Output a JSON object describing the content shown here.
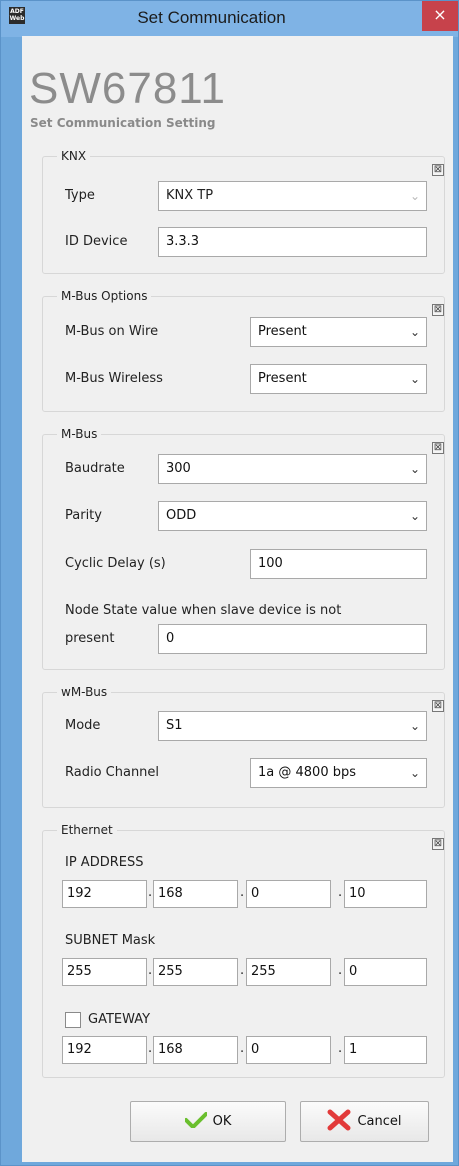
{
  "window": {
    "title": "Set Communication",
    "app_icon_text": "ADF\nWeb",
    "close_glyph": "×"
  },
  "header": {
    "logo": "SW67811",
    "subtitle": "Set Communication Setting"
  },
  "knx": {
    "legend": "KNX",
    "type_label": "Type",
    "type_value": "KNX TP",
    "id_device_label": "ID Device",
    "id_device_value": "3.3.3"
  },
  "mbus_options": {
    "legend": "M-Bus Options",
    "on_wire_label": "M-Bus on Wire",
    "on_wire_value": "Present",
    "wireless_label": "M-Bus Wireless",
    "wireless_value": "Present"
  },
  "mbus": {
    "legend": "M-Bus",
    "baudrate_label": "Baudrate",
    "baudrate_value": "300",
    "parity_label": "Parity",
    "parity_value": "ODD",
    "cyclic_delay_label": "Cyclic Delay (s)",
    "cyclic_delay_value": "100",
    "node_state_label_line1": "Node State value when slave device is not",
    "node_state_label_line2": "present",
    "node_state_value": "0"
  },
  "wmbus": {
    "legend": "wM-Bus",
    "mode_label": "Mode",
    "mode_value": "S1",
    "radio_channel_label": "Radio Channel",
    "radio_channel_value": "1a @ 4800 bps"
  },
  "ethernet": {
    "legend": "Ethernet",
    "ip_label": "IP ADDRESS",
    "ip": [
      "192",
      "168",
      "0",
      "10"
    ],
    "subnet_label": "SUBNET Mask",
    "subnet": [
      "255",
      "255",
      "255",
      "0"
    ],
    "gateway_label": "GATEWAY",
    "gateway_checked": false,
    "gateway": [
      "192",
      "168",
      "0",
      "1"
    ]
  },
  "buttons": {
    "ok": "OK",
    "cancel": "Cancel"
  },
  "glyphs": {
    "collapse": "⊠",
    "chevron": "⌄",
    "octet_sep": "."
  },
  "colors": {
    "titlebar": "#7fb3e5",
    "close": "#c7424b",
    "ok_icon": "#6abf2e",
    "cancel_icon": "#e23a3a"
  }
}
